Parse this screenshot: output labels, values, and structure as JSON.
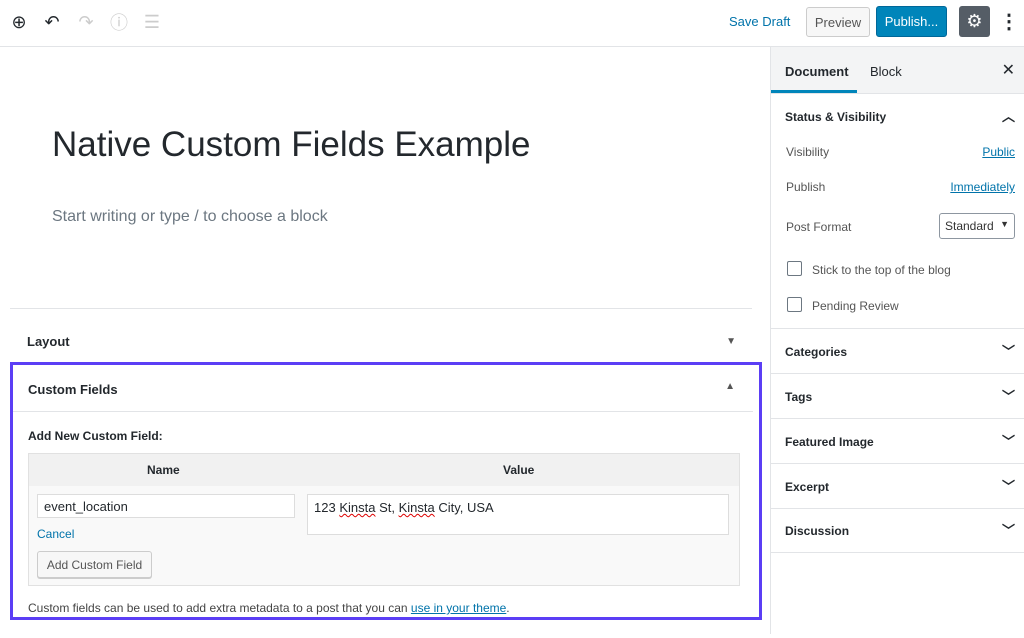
{
  "toolbar": {
    "save_draft": "Save Draft",
    "preview": "Preview",
    "publish": "Publish..."
  },
  "editor": {
    "title": "Native Custom Fields Example",
    "placeholder": "Start writing or type / to choose a block"
  },
  "meta_boxes": {
    "layout": "Layout",
    "custom_fields": {
      "title": "Custom Fields",
      "add_new": "Add New Custom Field:",
      "col_name": "Name",
      "col_value": "Value",
      "name_value": "event_location",
      "value_parts": [
        "123 ",
        "Kinsta",
        " St, ",
        "Kinsta",
        " City, USA"
      ],
      "cancel": "Cancel",
      "add_button": "Add Custom Field",
      "note": "Custom fields can be used to add extra metadata to a post that you can ",
      "note_link": "use in your theme",
      "note_end": "."
    }
  },
  "sidebar": {
    "tabs": [
      "Document",
      "Block"
    ],
    "status": {
      "title": "Status & Visibility",
      "visibility_label": "Visibility",
      "visibility_value": "Public",
      "publish_label": "Publish",
      "publish_value": "Immediately",
      "format_label": "Post Format",
      "format_value": "Standard",
      "sticky": "Stick to the top of the blog",
      "pending": "Pending Review"
    },
    "panels": [
      "Categories",
      "Tags",
      "Featured Image",
      "Excerpt",
      "Discussion"
    ]
  },
  "colors": {
    "accent": "#0085ba",
    "highlight": "#5b3ef5"
  }
}
